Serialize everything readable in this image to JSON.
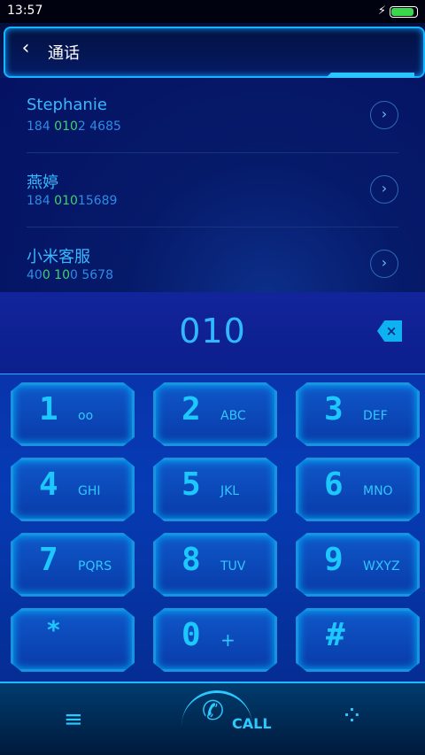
{
  "status": {
    "time": "13:57",
    "battery_level": 0.9
  },
  "header": {
    "title": "通话"
  },
  "contacts": [
    {
      "name": "Stephanie",
      "pre": "184 ",
      "hl": "010",
      "post": "2  4685"
    },
    {
      "name": "燕婷",
      "pre": "184 ",
      "hl": "010",
      "post": "15689"
    },
    {
      "name": "小米客服",
      "pre": "40",
      "hl": "0 10",
      "post": "0  5678"
    }
  ],
  "dialpad": {
    "number": "010",
    "keys": [
      {
        "digit": "1",
        "letters": "oo"
      },
      {
        "digit": "2",
        "letters": "ABC"
      },
      {
        "digit": "3",
        "letters": "DEF"
      },
      {
        "digit": "4",
        "letters": "GHI"
      },
      {
        "digit": "5",
        "letters": "JKL"
      },
      {
        "digit": "6",
        "letters": "MNO"
      },
      {
        "digit": "7",
        "letters": "PQRS"
      },
      {
        "digit": "8",
        "letters": "TUV"
      },
      {
        "digit": "9",
        "letters": "WXYZ"
      },
      {
        "digit": "*",
        "letters": ""
      },
      {
        "digit": "0",
        "letters": "+"
      },
      {
        "digit": "#",
        "letters": ""
      }
    ]
  },
  "bottom": {
    "call_label": "CALL"
  }
}
